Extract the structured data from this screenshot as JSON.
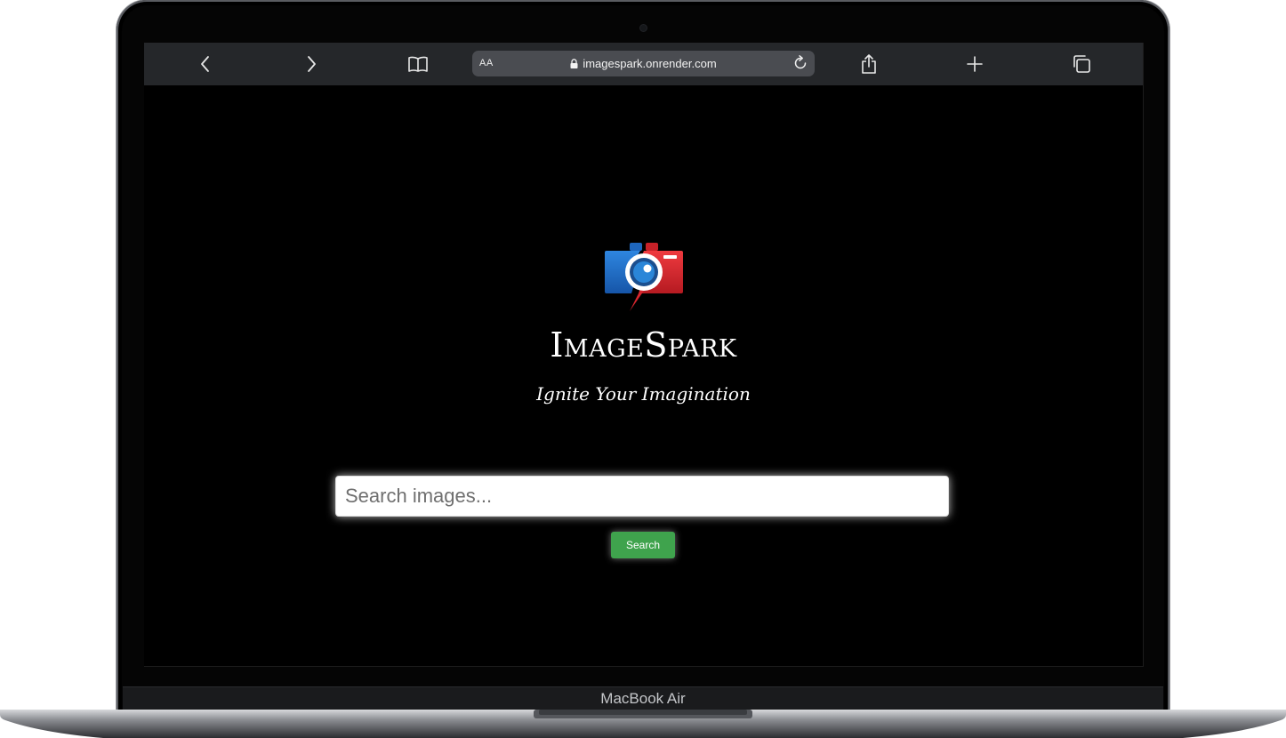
{
  "device": {
    "model_label": "MacBook Air"
  },
  "browser": {
    "text_size_label": "AA",
    "url": "imagespark.onrender.com",
    "icons": [
      "back-icon",
      "forward-icon",
      "bookmarks-icon",
      "lock-icon",
      "reload-icon",
      "share-icon",
      "new-tab-icon",
      "tabs-icon"
    ]
  },
  "page": {
    "brand": "ImageSpark",
    "tagline": "Ignite Your Imagination",
    "search": {
      "placeholder": "Search images...",
      "value": "",
      "button_label": "Search"
    }
  },
  "colors": {
    "page_background": "#000000",
    "toolbar_background": "#25272a",
    "url_bar": "#4a4c51",
    "search_button": "#3fa34d",
    "logo_blue": "#1f6fc9",
    "logo_red": "#d8262e"
  }
}
